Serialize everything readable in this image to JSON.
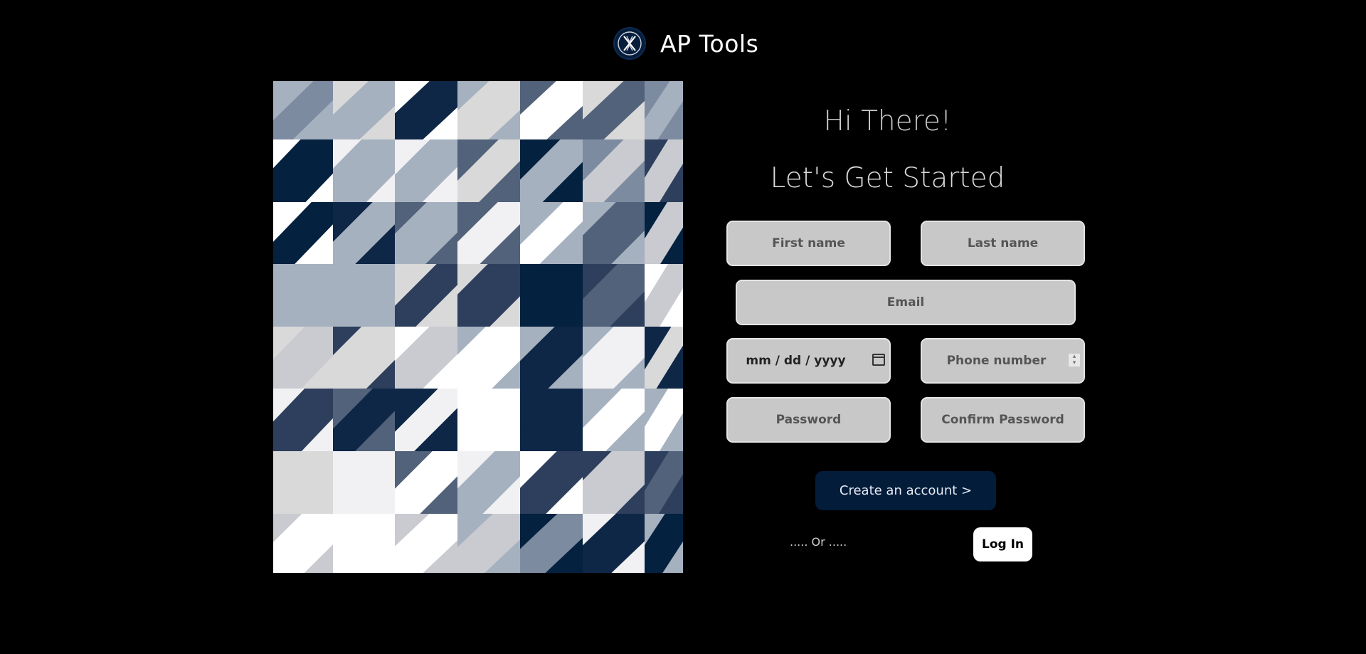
{
  "brand": {
    "name": "AP Tools",
    "logo_icon": "ap-tools-logo-icon"
  },
  "greeting": {
    "title": "Hi There!",
    "subtitle": "Let's Get Started"
  },
  "form": {
    "first_name_placeholder": "First name",
    "last_name_placeholder": "Last name",
    "email_placeholder": "Email",
    "date_placeholder": "mm / dd / yyyy",
    "phone_placeholder": "Phone number",
    "password_placeholder": "Password",
    "confirm_password_placeholder": "Confirm Password",
    "create_label": "Create an account >",
    "or_label": "..... Or .....",
    "login_label": "Log In"
  },
  "colors": {
    "background": "#000000",
    "field": "#c8c8c8",
    "accent": "#031c3a",
    "navy": "#04213f"
  }
}
